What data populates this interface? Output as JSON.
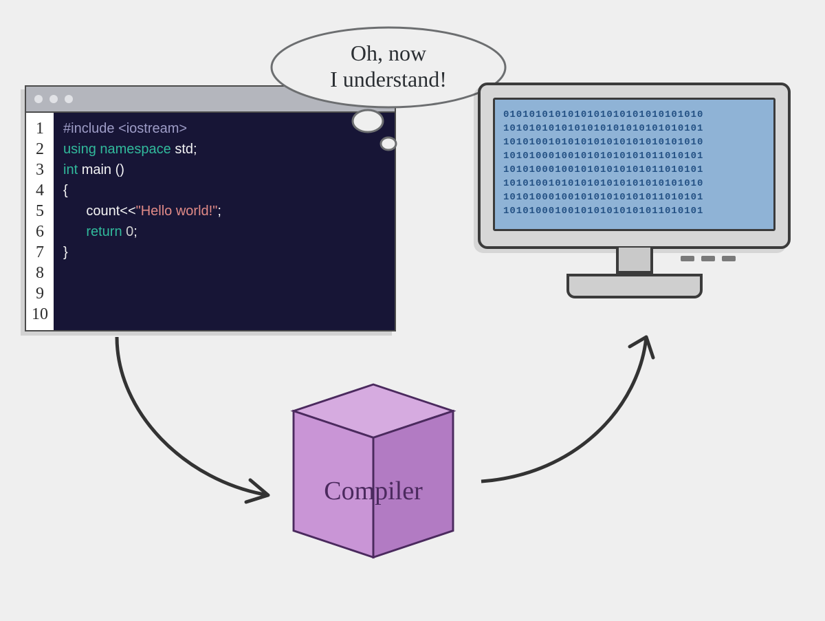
{
  "editor": {
    "line_count": 10,
    "tokens": [
      [
        {
          "c": "tok-pp",
          "t": "#include "
        },
        {
          "c": "tok-pp",
          "t": "<iostream>"
        }
      ],
      [
        {
          "c": "tok-kw",
          "t": "using namespace "
        },
        {
          "c": "tok-id",
          "t": "std;"
        }
      ],
      [
        {
          "c": "tok-ty",
          "t": "int "
        },
        {
          "c": "tok-id",
          "t": "main ()"
        }
      ],
      [
        {
          "c": "tok-pl",
          "t": "{"
        }
      ],
      [
        {
          "c": "tok-pl",
          "t": "      count<<"
        },
        {
          "c": "tok-str",
          "t": "\"Hello world!\""
        },
        {
          "c": "tok-pl",
          "t": ";"
        }
      ],
      [
        {
          "c": "tok-kw",
          "t": "      return "
        },
        {
          "c": "tok-num",
          "t": "0"
        },
        {
          "c": "tok-pl",
          "t": ";"
        }
      ],
      [
        {
          "c": "tok-pl",
          "t": "}"
        }
      ]
    ]
  },
  "monitor": {
    "binary_rows": [
      "0101010101010101010101010101010",
      "1010101010101010101010101010101",
      "1010100101010101010101010101010",
      "1010100010010101010101011010101",
      "1010100010010101010101011010101",
      "1010100101010101010101010101010",
      "1010100010010101010101011010101",
      "1010100010010101010101011010101"
    ]
  },
  "bubble": {
    "line1": "Oh, now",
    "line2": "I understand!"
  },
  "compiler": {
    "label": "Compiler"
  }
}
